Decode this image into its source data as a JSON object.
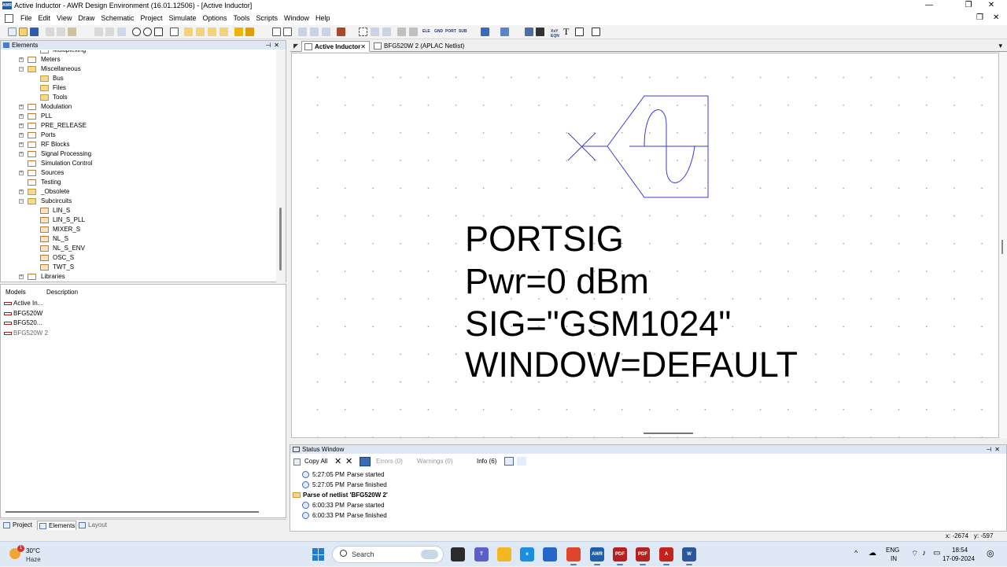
{
  "window": {
    "title": "Active Inductor - AWR Design Environment (16.01.12506) - [Active Inductor]",
    "app_badge": "AWR",
    "minimize": "—",
    "maximize": "❐",
    "close": "✕",
    "mdi_restore": "❐",
    "mdi_close": "✕"
  },
  "menu": [
    "File",
    "Edit",
    "View",
    "Draw",
    "Schematic",
    "Project",
    "Simulate",
    "Options",
    "Tools",
    "Scripts",
    "Window",
    "Help"
  ],
  "toolbar": {
    "text_buttons": [
      "ELE",
      "GND",
      "PORT",
      "SUB",
      "XxY",
      "EQN",
      "T"
    ]
  },
  "elements_panel": {
    "title": "Elements",
    "pin": "⊣",
    "close": "✕",
    "tree": [
      {
        "label": "Multiplexing",
        "level": 2,
        "icon": "block"
      },
      {
        "label": "Meters",
        "level": 1,
        "expander": "+",
        "icon": "block"
      },
      {
        "label": "Miscellaneous",
        "level": 1,
        "expander": "−",
        "icon": "folder"
      },
      {
        "label": "Bus",
        "level": 2,
        "icon": "folder"
      },
      {
        "label": "Files",
        "level": 2,
        "icon": "folder"
      },
      {
        "label": "Tools",
        "level": 2,
        "icon": "folder"
      },
      {
        "label": "Modulation",
        "level": 1,
        "expander": "+",
        "icon": "block"
      },
      {
        "label": "PLL",
        "level": 1,
        "expander": "+",
        "icon": "block"
      },
      {
        "label": "PRE_RELEASE",
        "level": 1,
        "expander": "+",
        "icon": "block"
      },
      {
        "label": "Ports",
        "level": 1,
        "expander": "+",
        "icon": "block"
      },
      {
        "label": "RF Blocks",
        "level": 1,
        "expander": "+",
        "icon": "block"
      },
      {
        "label": "Signal Processing",
        "level": 1,
        "expander": "+",
        "icon": "block"
      },
      {
        "label": "Simulation Control",
        "level": 1,
        "icon": "block"
      },
      {
        "label": "Sources",
        "level": 1,
        "expander": "+",
        "icon": "block"
      },
      {
        "label": "Testing",
        "level": 1,
        "icon": "block"
      },
      {
        "label": "_Obsolete",
        "level": 1,
        "expander": "+",
        "icon": "folder"
      },
      {
        "label": "Subcircuits",
        "level": 1,
        "expander": "−",
        "icon": "folder"
      },
      {
        "label": "LIN_S",
        "level": 2,
        "icon": "sub"
      },
      {
        "label": "LIN_S_PLL",
        "level": 2,
        "icon": "sub"
      },
      {
        "label": "MIXER_S",
        "level": 2,
        "icon": "sub"
      },
      {
        "label": "NL_S",
        "level": 2,
        "icon": "sub"
      },
      {
        "label": "NL_S_ENV",
        "level": 2,
        "icon": "sub"
      },
      {
        "label": "OSC_S",
        "level": 2,
        "icon": "sub"
      },
      {
        "label": "TWT_S",
        "level": 2,
        "icon": "sub"
      },
      {
        "label": "Libraries",
        "level": 1,
        "expander": "+",
        "icon": "block"
      }
    ]
  },
  "models_panel": {
    "col_models": "Models",
    "col_description": "Description",
    "rows": [
      {
        "label": "Active In...",
        "dim": false
      },
      {
        "label": "BFG520W",
        "dim": false
      },
      {
        "label": "BFG520...",
        "dim": false
      },
      {
        "label": "BFG520W 2",
        "dim": true
      }
    ]
  },
  "left_tabs": [
    "Project",
    "Elements",
    "Layout"
  ],
  "doc_tabs": [
    {
      "label": "Active Inductor",
      "close": "✕",
      "active": true
    },
    {
      "label": "BFG520W 2 (APLAC Netlist)",
      "active": false
    }
  ],
  "doc_tabs_close": "▾",
  "schematic": {
    "element_name": "PORTSIG",
    "params": [
      "Pwr=0 dBm",
      "SIG=\"GSM1024\"",
      "WINDOW=DEFAULT"
    ],
    "symbol_color": "#3b3bd6"
  },
  "status_window": {
    "title": "Status Window",
    "pin": "⊣",
    "close": "✕",
    "copy_all": "Copy All",
    "errors": "Errors (0)",
    "warnings": "Warnings (0)",
    "info": "Info (6)",
    "log": [
      {
        "type": "item",
        "time": "5:27:05 PM",
        "msg": "Parse started"
      },
      {
        "type": "item",
        "time": "5:27:05 PM",
        "msg": "Parse finished"
      },
      {
        "type": "group",
        "msg": "Parse of netlist 'BFG520W 2'"
      },
      {
        "type": "item",
        "time": "6:00:33 PM",
        "msg": "Parse started"
      },
      {
        "type": "item",
        "time": "6:00:33 PM",
        "msg": "Parse finished"
      }
    ]
  },
  "coords": {
    "x": "x: -2674",
    "y": "y: -597"
  },
  "taskbar": {
    "temp": "30°C",
    "condition": "Haze",
    "weather_badge": "1",
    "search_placeholder": "Search",
    "apps": [
      {
        "name": "widgets",
        "color": "#2b2b2b",
        "label": ""
      },
      {
        "name": "teams",
        "color": "#5b5fc7",
        "label": "T"
      },
      {
        "name": "file-explorer",
        "color": "#f2b824",
        "label": ""
      },
      {
        "name": "edge",
        "color": "#1b8ee0",
        "label": "e"
      },
      {
        "name": "store",
        "color": "#2467c9",
        "label": ""
      },
      {
        "name": "chrome",
        "color": "#e0452c",
        "label": ""
      },
      {
        "name": "awr",
        "color": "#1f5fa8",
        "label": "AWR"
      },
      {
        "name": "pdf-tool-1",
        "color": "#b22222",
        "label": "PDF"
      },
      {
        "name": "pdf-tool-2",
        "color": "#b22222",
        "label": "PDF"
      },
      {
        "name": "acrobat",
        "color": "#c4221f",
        "label": "A"
      },
      {
        "name": "word",
        "color": "#2b579a",
        "label": "W"
      }
    ],
    "lang": "ENG",
    "region": "IN",
    "time": "18:54",
    "date": "17-09-2024"
  }
}
